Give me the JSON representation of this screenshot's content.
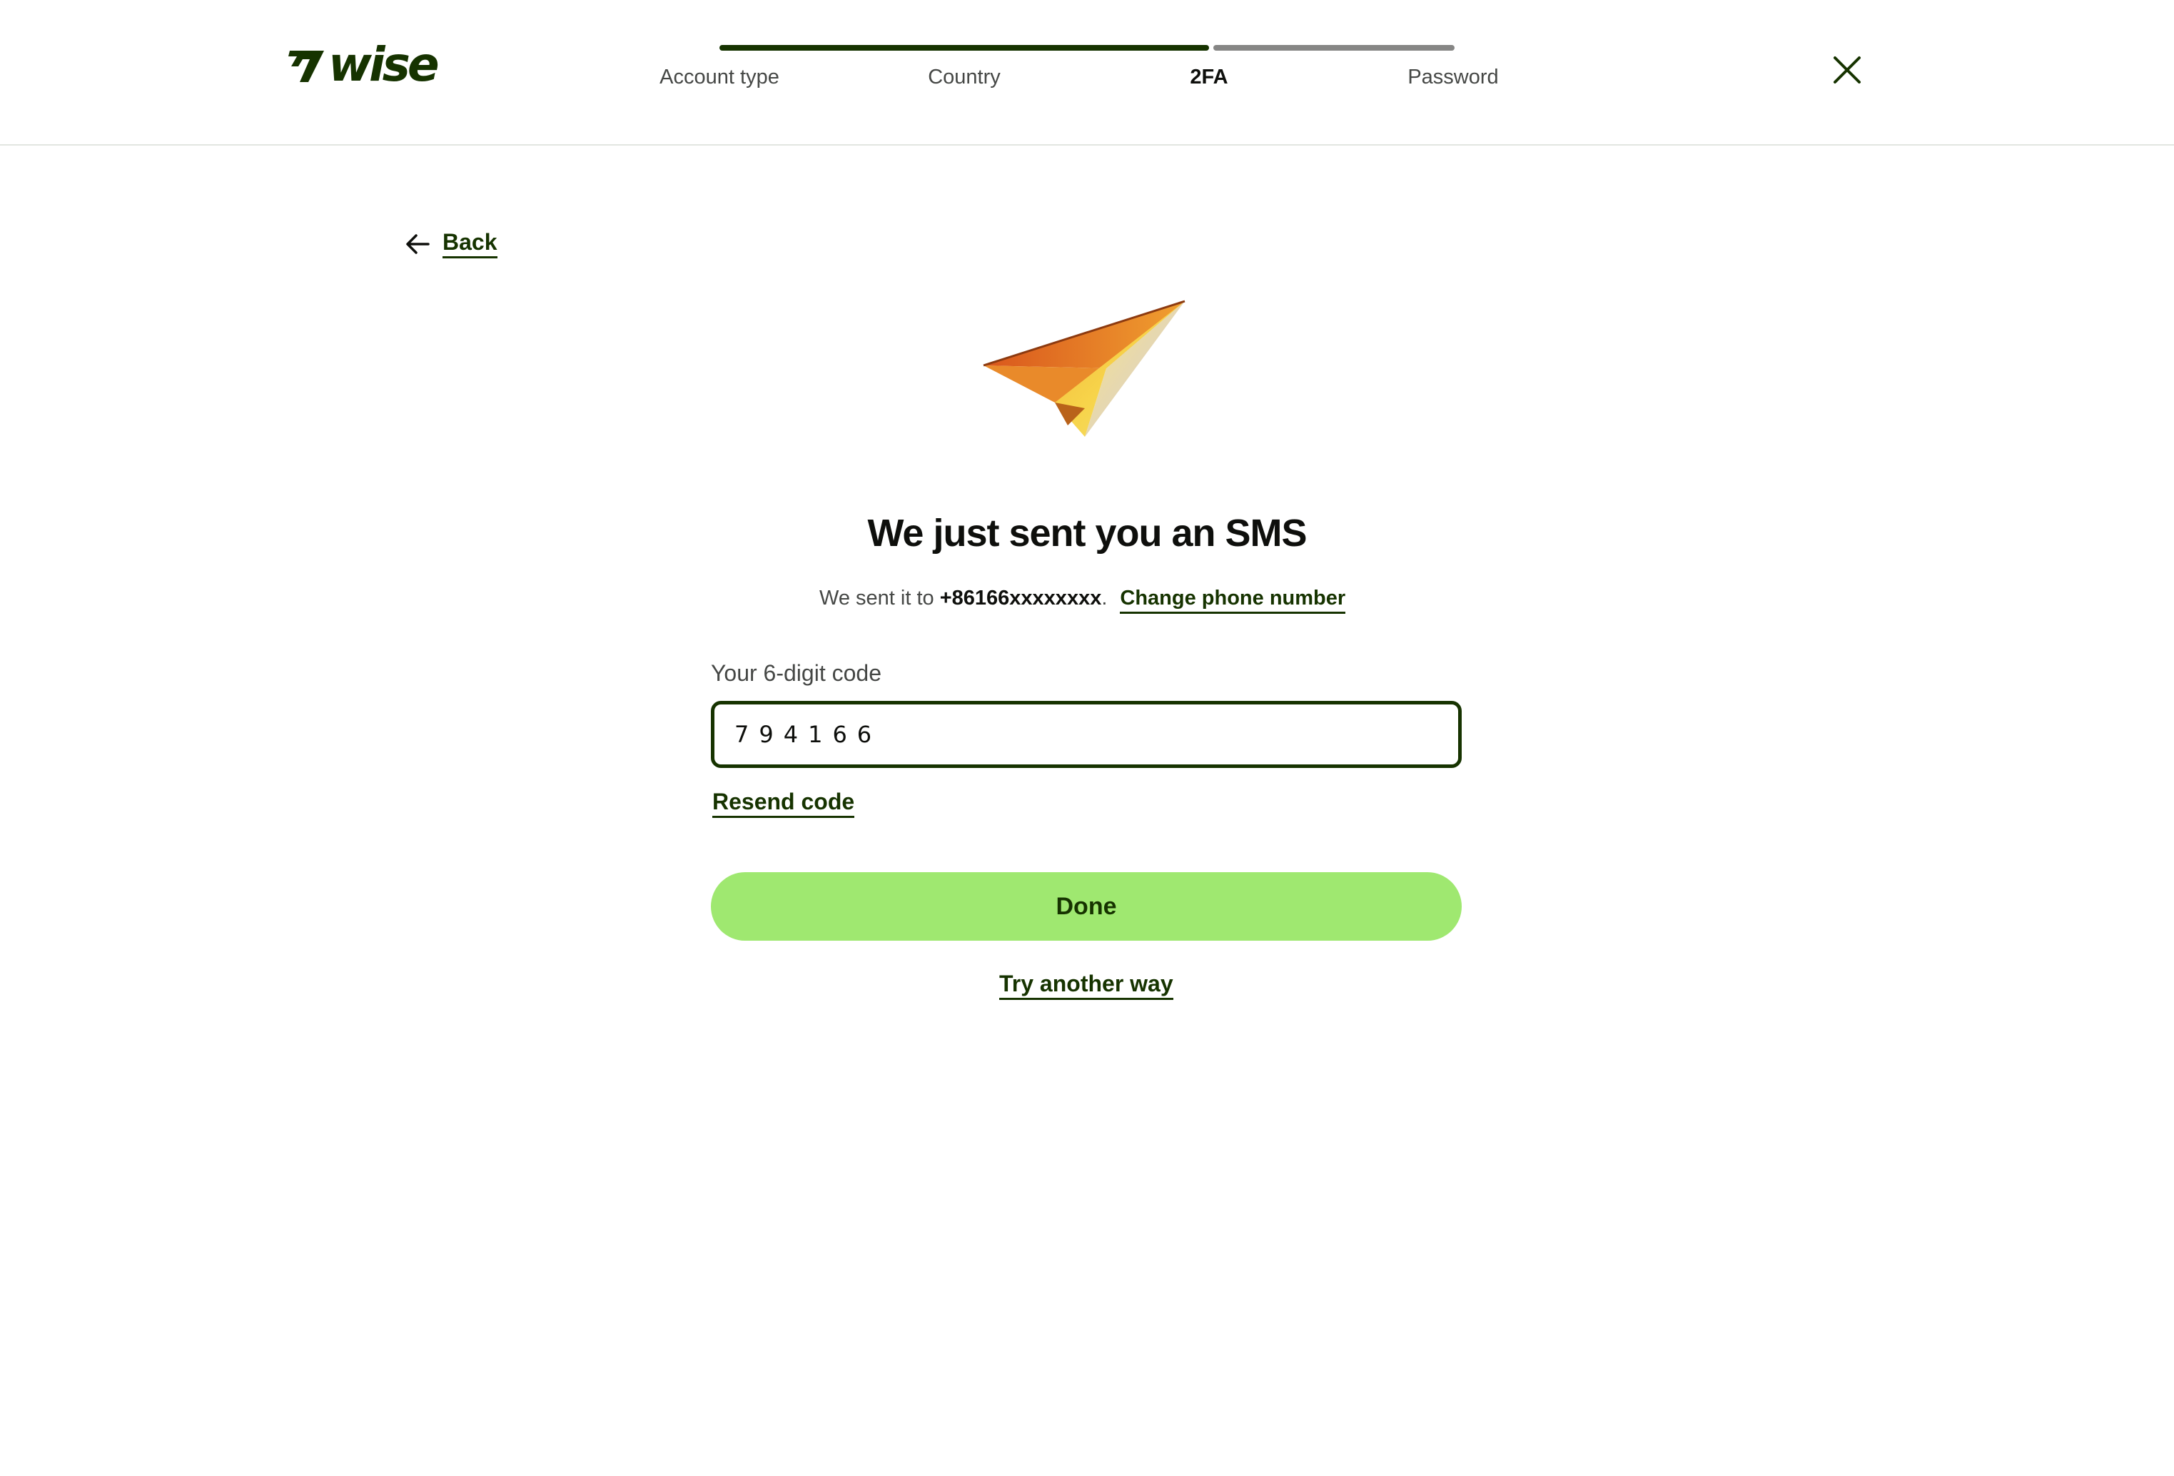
{
  "brand": {
    "name": "wise",
    "color": "#163300",
    "accent": "#9fe870"
  },
  "stepper": {
    "steps": [
      {
        "label": "Account type",
        "state": "done"
      },
      {
        "label": "Country",
        "state": "done"
      },
      {
        "label": "2FA",
        "state": "active"
      },
      {
        "label": "Password",
        "state": "todo"
      }
    ]
  },
  "header": {
    "close_icon": "close-icon"
  },
  "nav": {
    "back_label": "Back",
    "back_icon": "arrow-left-icon"
  },
  "illustration": {
    "icon": "paper-plane-icon"
  },
  "main": {
    "title": "We just sent you an SMS",
    "sent_prefix": "We sent it to ",
    "phone": "+86166xxxxxxxx",
    "sent_suffix": ".",
    "change_phone_label": "Change phone number",
    "code_label": "Your 6-digit code",
    "code_value": "794166",
    "resend_label": "Resend code",
    "done_label": "Done",
    "try_another_label": "Try another way"
  }
}
